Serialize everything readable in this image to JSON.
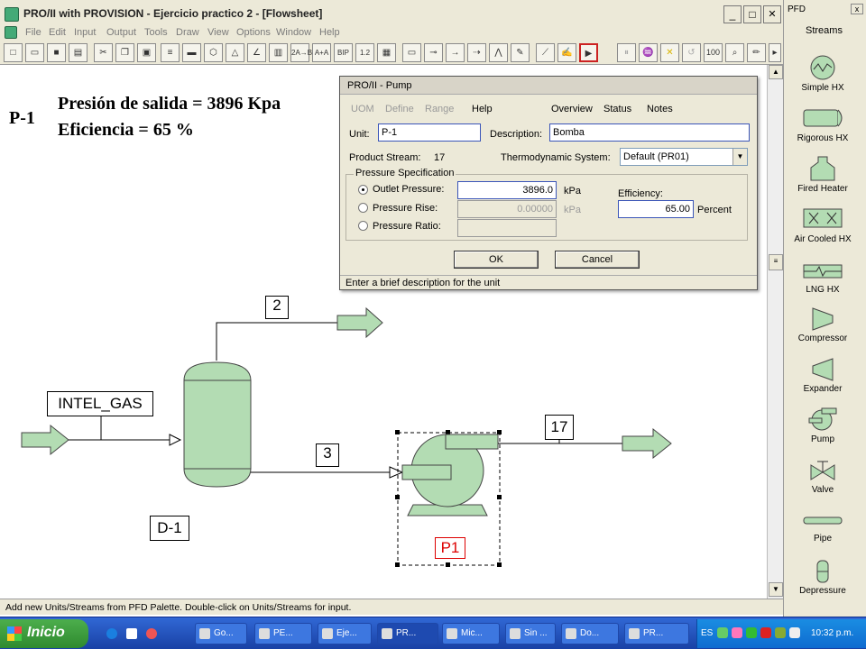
{
  "window": {
    "title": "PRO/II with PROVISION - Ejercicio practico 2 - [Flowsheet]",
    "min": "_",
    "max": "□",
    "close": "✕"
  },
  "menu": [
    "File",
    "Edit",
    "Input",
    "Output",
    "Tools",
    "Draw",
    "View",
    "Options",
    "Window",
    "Help"
  ],
  "annotation": {
    "tag": "P-1",
    "line1": "Presión de salida = 3896 Kpa",
    "line2": "Eficiencia = 65 %"
  },
  "dialog": {
    "title": "PRO/II - Pump",
    "menu": {
      "uom": "UOM",
      "define": "Define",
      "range": "Range",
      "help": "Help",
      "overview": "Overview",
      "status": "Status",
      "notes": "Notes"
    },
    "unit_label": "Unit:",
    "unit_value": "P-1",
    "description_label": "Description:",
    "description_value": "Bomba",
    "product_stream_label": "Product Stream:",
    "product_stream_value": "17",
    "thermo_label": "Thermodynamic System:",
    "thermo_value": "Default (PR01)",
    "pressure_group": "Pressure Specification",
    "outlet_label": "Outlet Pressure:",
    "outlet_value": "3896.0",
    "outlet_unit": "kPa",
    "rise_label": "Pressure Rise:",
    "rise_value": "0.00000",
    "rise_unit": "kPa",
    "ratio_label": "Pressure Ratio:",
    "ratio_value": "",
    "efficiency_label": "Efficiency:",
    "efficiency_value": "65.00",
    "efficiency_unit": "Percent",
    "ok": "OK",
    "cancel": "Cancel",
    "status": "Enter a brief description for the unit"
  },
  "flowsheet": {
    "stream_2": "2",
    "stream_3": "3",
    "stream_17": "17",
    "feed": "INTEL_GAS",
    "drum": "D-1",
    "pump": "P1"
  },
  "statusbar": "Add new Units/Streams from PFD Palette.  Double-click on Units/Streams for input.",
  "palette": {
    "header": "PFD",
    "close": "x",
    "title": "Streams",
    "items": [
      {
        "label": "Simple HX",
        "icon": "simple-hx-icon"
      },
      {
        "label": "Rigorous HX",
        "icon": "rigorous-hx-icon"
      },
      {
        "label": "Fired Heater",
        "icon": "fired-heater-icon"
      },
      {
        "label": "Air Cooled HX",
        "icon": "air-cooled-hx-icon"
      },
      {
        "label": "LNG HX",
        "icon": "lng-hx-icon"
      },
      {
        "label": "Compressor",
        "icon": "compressor-icon"
      },
      {
        "label": "Expander",
        "icon": "expander-icon"
      },
      {
        "label": "Pump",
        "icon": "pump-icon"
      },
      {
        "label": "Valve",
        "icon": "valve-icon"
      },
      {
        "label": "Pipe",
        "icon": "pipe-icon"
      },
      {
        "label": "Depressure",
        "icon": "depressure-icon"
      }
    ]
  },
  "taskbar": {
    "start": "Inicio",
    "tasks": [
      "Go...",
      "PE...",
      "Eje...",
      "PR...",
      "Mic...",
      "Sin ...",
      "Do...",
      "PR..."
    ],
    "lang": "ES",
    "clock": "10:32 p.m."
  }
}
